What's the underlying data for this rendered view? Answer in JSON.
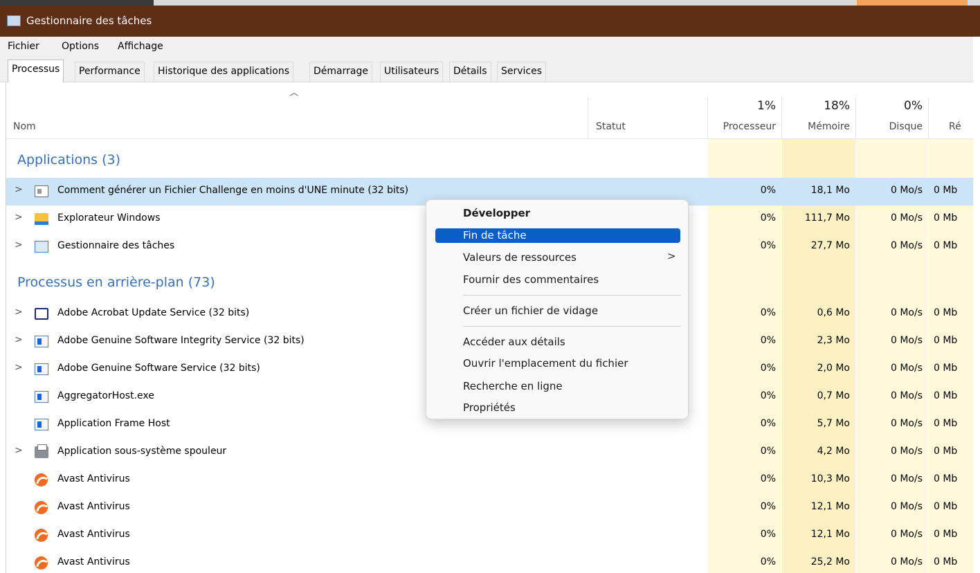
{
  "window": {
    "title": "Gestionnaire des tâches"
  },
  "menu": [
    "Fichier",
    "Options",
    "Affichage"
  ],
  "tabs": [
    {
      "label": "Processus",
      "active": true
    },
    {
      "label": "Performance"
    },
    {
      "label": "Historique des applications"
    },
    {
      "label": "Démarrage"
    },
    {
      "label": "Utilisateurs"
    },
    {
      "label": "Détails"
    },
    {
      "label": "Services"
    }
  ],
  "columns": {
    "name": "Nom",
    "status": "Statut",
    "cpu": {
      "label": "Processeur",
      "pct": "1%"
    },
    "memory": {
      "label": "Mémoire",
      "pct": "18%"
    },
    "disk": {
      "label": "Disque",
      "pct": "0%"
    },
    "network": {
      "label": "Ré"
    }
  },
  "groups": {
    "apps": "Applications (3)",
    "background": "Processus en arrière-plan (73)"
  },
  "rows": [
    {
      "name": "Comment générer un Fichier Challenge en moins d'UNE minute (32 bits)",
      "icon": "window-icon",
      "expandable": true,
      "cpu": "0%",
      "memory": "18,1 Mo",
      "disk": "0 Mo/s",
      "network": "0 Mb"
    },
    {
      "name": "Explorateur Windows",
      "icon": "folder-icon",
      "expandable": true,
      "cpu": "0%",
      "memory": "111,7 Mo",
      "disk": "0 Mo/s",
      "network": "0 Mb"
    },
    {
      "name": "Gestionnaire des tâches",
      "icon": "task-manager-icon",
      "expandable": true,
      "cpu": "0%",
      "memory": "27,7 Mo",
      "disk": "0 Mo/s",
      "network": "0 Mb"
    },
    {
      "name": "Adobe Acrobat Update Service (32 bits)",
      "icon": "acrobat-icon",
      "expandable": true,
      "cpu": "0%",
      "memory": "0,6 Mo",
      "disk": "0 Mo/s",
      "network": "0 Mb"
    },
    {
      "name": "Adobe Genuine Software Integrity Service (32 bits)",
      "icon": "service-icon",
      "expandable": true,
      "cpu": "0%",
      "memory": "2,3 Mo",
      "disk": "0 Mo/s",
      "network": "0 Mb"
    },
    {
      "name": "Adobe Genuine Software Service (32 bits)",
      "icon": "service-icon",
      "expandable": true,
      "cpu": "0%",
      "memory": "2,0 Mo",
      "disk": "0 Mo/s",
      "network": "0 Mb"
    },
    {
      "name": "AggregatorHost.exe",
      "icon": "service-icon",
      "expandable": false,
      "cpu": "0%",
      "memory": "0,7 Mo",
      "disk": "0 Mo/s",
      "network": "0 Mb"
    },
    {
      "name": "Application Frame Host",
      "icon": "service-icon",
      "expandable": false,
      "cpu": "0%",
      "memory": "5,7 Mo",
      "disk": "0 Mo/s",
      "network": "0 Mb"
    },
    {
      "name": "Application sous-système spouleur",
      "icon": "printer-icon",
      "expandable": true,
      "cpu": "0%",
      "memory": "4,2 Mo",
      "disk": "0 Mo/s",
      "network": "0 Mb"
    },
    {
      "name": "Avast Antivirus",
      "icon": "avast-icon",
      "expandable": false,
      "cpu": "0%",
      "memory": "10,3 Mo",
      "disk": "0 Mo/s",
      "network": "0 Mb"
    },
    {
      "name": "Avast Antivirus",
      "icon": "avast-icon",
      "expandable": false,
      "cpu": "0%",
      "memory": "12,1 Mo",
      "disk": "0 Mo/s",
      "network": "0 Mb"
    },
    {
      "name": "Avast Antivirus",
      "icon": "avast-icon",
      "expandable": false,
      "cpu": "0%",
      "memory": "12,1 Mo",
      "disk": "0 Mo/s",
      "network": "0 Mb"
    },
    {
      "name": "Avast Antivirus",
      "icon": "avast-icon",
      "expandable": false,
      "cpu": "0%",
      "memory": "25,2 Mo",
      "disk": "0 Mo/s",
      "network": "0 Mb"
    }
  ],
  "context_menu": {
    "expand": "Développer",
    "end_task": "Fin de tâche",
    "resource_values": "Valeurs de ressources",
    "feedback": "Fournir des commentaires",
    "dump": "Créer un fichier de vidage",
    "details": "Accéder aux détails",
    "open_location": "Ouvrir l'emplacement du fichier",
    "search_online": "Recherche en ligne",
    "properties": "Propriétés",
    "submenu_arrow": ">"
  },
  "glyphs": {
    "expand_chevron": ">",
    "sort_chevron": "^"
  },
  "colors": {
    "accent": "#0a5ec8",
    "titlebar": "#5e2f16",
    "group": "#3a6db3",
    "selected_row": "#cce4f7"
  }
}
